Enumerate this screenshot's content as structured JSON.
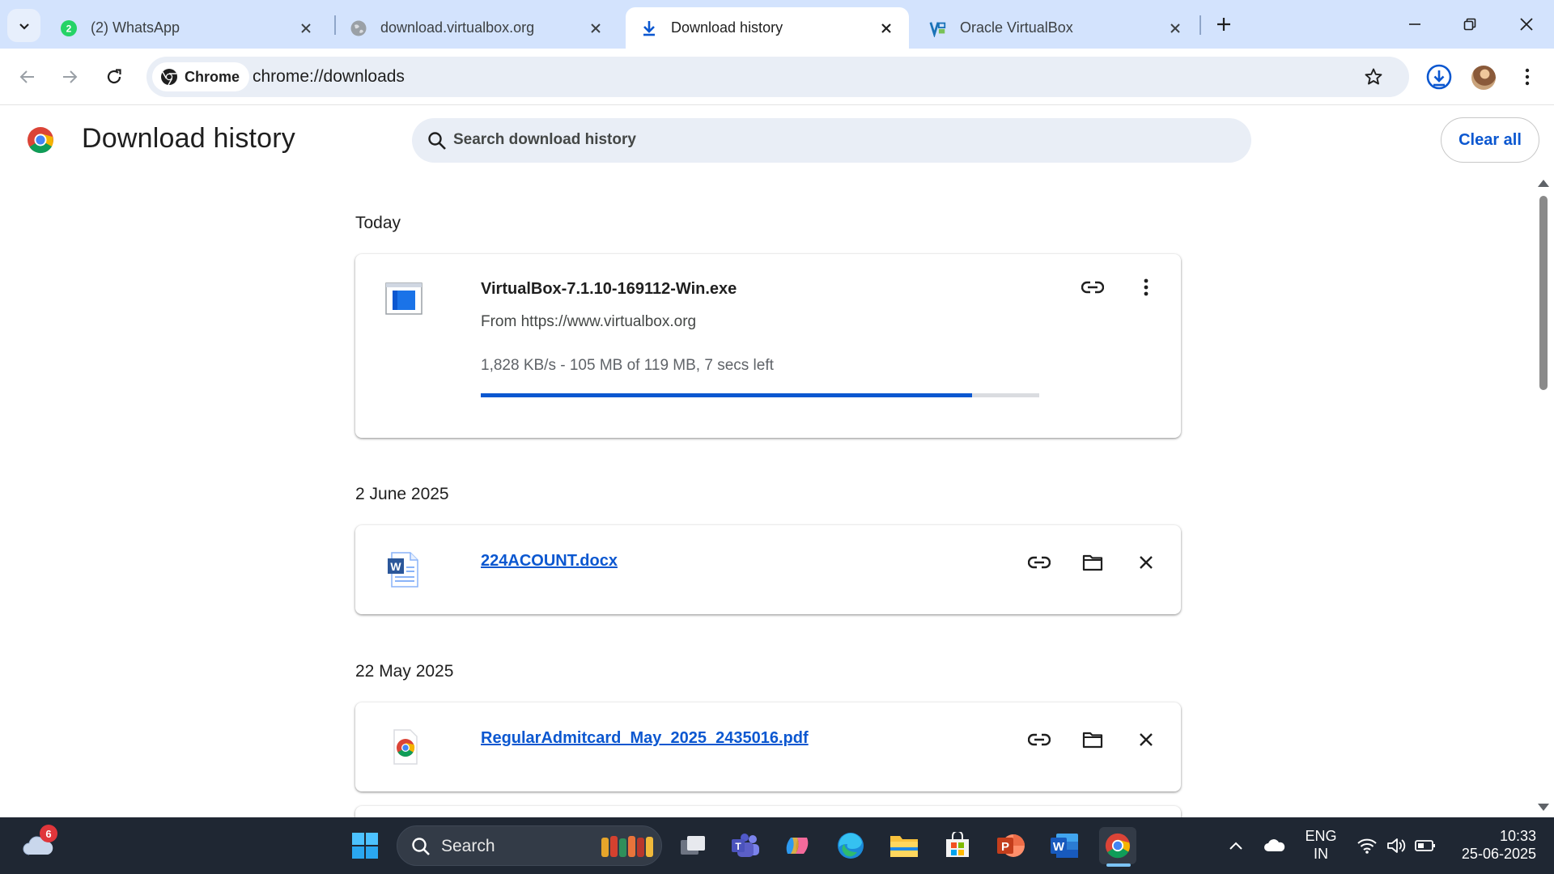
{
  "browser": {
    "tabs": [
      {
        "title": "(2) WhatsApp",
        "icon": "whatsapp-icon",
        "active": false
      },
      {
        "title": "download.virtualbox.org",
        "icon": "globe-icon",
        "active": false
      },
      {
        "title": "Download history",
        "icon": "download-icon",
        "active": true
      },
      {
        "title": "Oracle VirtualBox",
        "icon": "virtualbox-icon",
        "active": false
      }
    ],
    "whatsapp_badge": "2",
    "chip_label": "Chrome",
    "url": "chrome://downloads"
  },
  "page": {
    "title": "Download history",
    "search_placeholder": "Search download history",
    "clear_all_label": "Clear all"
  },
  "groups": [
    {
      "date": "Today",
      "items": [
        {
          "name": "VirtualBox-7.1.10-169112-Win.exe",
          "from": "From https://www.virtualbox.org",
          "status": "1,828 KB/s - 105 MB of 119 MB, 7 secs left",
          "progress_fraction": 0.88,
          "in_progress": true
        }
      ]
    },
    {
      "date": "2 June 2025",
      "items": [
        {
          "name": "224ACOUNT.docx",
          "in_progress": false
        }
      ]
    },
    {
      "date": "22 May 2025",
      "items": [
        {
          "name": "RegularAdmitcard_May_2025_2435016.pdf",
          "in_progress": false
        }
      ]
    }
  ],
  "taskbar": {
    "weather_badge": "6",
    "search_label": "Search",
    "language_line1": "ENG",
    "language_line2": "IN",
    "time": "10:33",
    "date": "25-06-2025"
  },
  "colors": {
    "accent": "#0b57d0",
    "tabstrip": "#d3e3fd",
    "taskbar": "#1f2733"
  }
}
